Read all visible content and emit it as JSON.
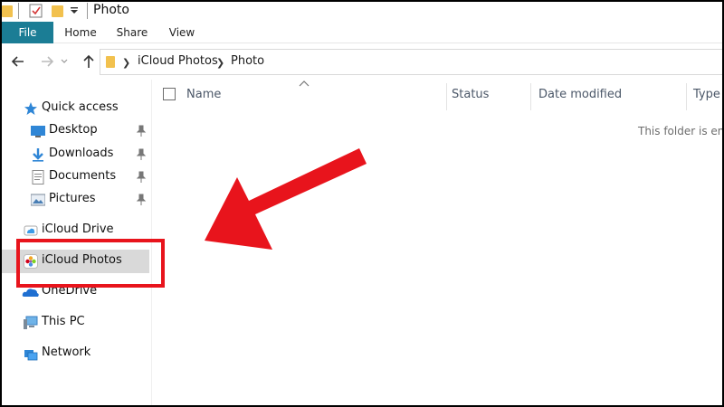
{
  "window": {
    "title": "Photo"
  },
  "ribbon": {
    "tabs": [
      {
        "label": "File"
      },
      {
        "label": "Home"
      },
      {
        "label": "Share"
      },
      {
        "label": "View"
      }
    ]
  },
  "address": {
    "crumbs": [
      "iCloud Photos",
      "Photo"
    ]
  },
  "sidebar": {
    "quick_access": "Quick access",
    "pinned": [
      {
        "label": "Desktop",
        "icon": "desktop-icon"
      },
      {
        "label": "Downloads",
        "icon": "downloads-icon"
      },
      {
        "label": "Documents",
        "icon": "documents-icon"
      },
      {
        "label": "Pictures",
        "icon": "pictures-icon"
      }
    ],
    "icloud_drive": "iCloud Drive",
    "icloud_photos": "iCloud Photos",
    "onedrive": "OneDrive",
    "this_pc": "This PC",
    "network": "Network"
  },
  "columns": {
    "name": "Name",
    "status": "Status",
    "date_modified": "Date modified",
    "type": "Type"
  },
  "content": {
    "empty_message": "This folder is em"
  },
  "colors": {
    "accent_file_tab": "#1b7d95",
    "annotation_red": "#e8141c",
    "selected_bg": "#d9d9d9"
  }
}
